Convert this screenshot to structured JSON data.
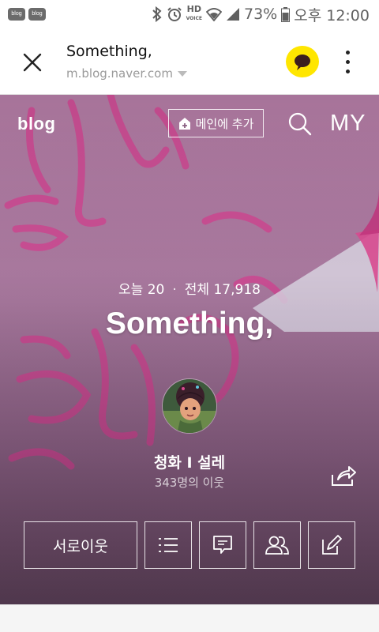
{
  "status_bar": {
    "notifications": [
      {
        "icon": "blog-notification-icon",
        "label": "blog"
      },
      {
        "icon": "blog-notification-icon",
        "label": "blog"
      }
    ],
    "icons": [
      "bluetooth-icon",
      "alarm-icon",
      "hd-voice-icon",
      "wifi-icon",
      "signal-icon"
    ],
    "hd_voice": "HD",
    "battery": "73%",
    "time": "오후 12:00"
  },
  "browser": {
    "title": "Something,",
    "url": "m.blog.naver.com",
    "share_color": "#ffe600"
  },
  "cover": {
    "logo": "blog",
    "add_main_label": "메인에 추가",
    "my_label": "MY",
    "visits": {
      "today_label": "오늘 20",
      "separator": "·",
      "total_label": "전체 17,918"
    },
    "blog_title": "Something,",
    "nickname": "청화 I 설레",
    "neighbors": "343명의 이웃",
    "buttons": {
      "neighbor_label": "서로이웃"
    }
  },
  "colors": {
    "cover_top": "#b07aa2",
    "cover_bottom": "#644a60",
    "kakao": "#ffe600"
  }
}
